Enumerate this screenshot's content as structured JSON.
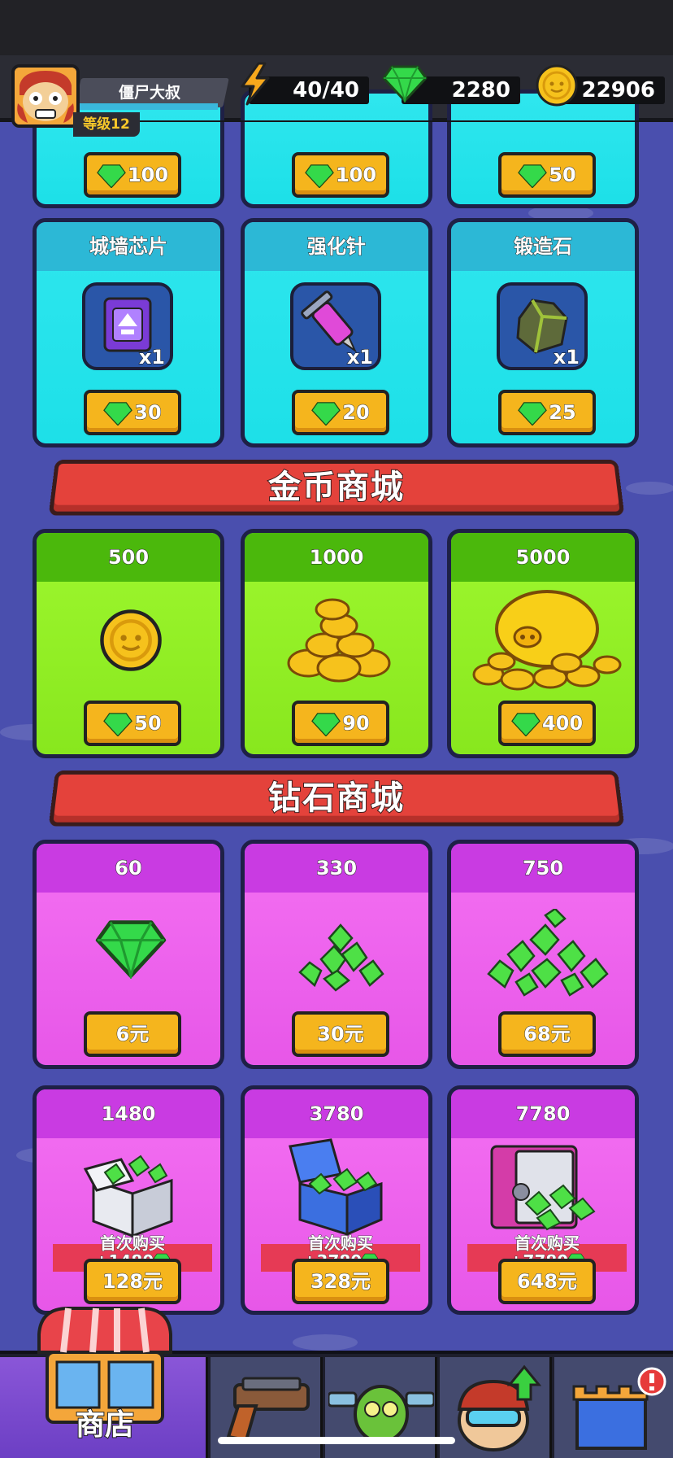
{
  "player": {
    "name": "僵尸大叔",
    "level": "等级12"
  },
  "resources": {
    "energy": "40/40",
    "gems": "2280",
    "coins": "22906"
  },
  "top_row": {
    "prices": [
      "100",
      "100",
      "50"
    ]
  },
  "item_row": [
    {
      "title": "城墙芯片",
      "qty": "x1",
      "price": "30",
      "icon": "wall-chip-icon"
    },
    {
      "title": "强化针",
      "qty": "x1",
      "price": "20",
      "icon": "syringe-icon"
    },
    {
      "title": "锻造石",
      "qty": "x1",
      "price": "25",
      "icon": "forge-stone-icon"
    }
  ],
  "gold_shop": {
    "title": "金币商城",
    "items": [
      {
        "amount": "500",
        "price": "50",
        "icon": "coin-icon"
      },
      {
        "amount": "1000",
        "price": "90",
        "icon": "coin-pile-icon"
      },
      {
        "amount": "5000",
        "price": "400",
        "icon": "gold-piggy-icon"
      }
    ]
  },
  "gem_shop": {
    "title": "钻石商城",
    "items": [
      {
        "amount": "60",
        "price": "6元",
        "icon": "gem-icon"
      },
      {
        "amount": "330",
        "price": "30元",
        "icon": "gem-pile-icon"
      },
      {
        "amount": "750",
        "price": "68元",
        "icon": "gem-big-pile-icon"
      },
      {
        "amount": "1480",
        "price": "128元",
        "first_buy": "首次购买",
        "bonus": "+1480",
        "icon": "gem-box-icon"
      },
      {
        "amount": "3780",
        "price": "328元",
        "first_buy": "首次购买",
        "bonus": "+3780",
        "icon": "gem-chest-icon"
      },
      {
        "amount": "7780",
        "price": "648元",
        "first_buy": "首次购买",
        "bonus": "+7780",
        "icon": "gem-safe-icon"
      }
    ]
  },
  "nav": {
    "shop_label": "商店",
    "tabs": [
      "shop-tab",
      "weapon-tab",
      "hero-tab",
      "upgrade-tab",
      "castle-tab"
    ]
  },
  "colors": {
    "cyan_card": "#1de0e8",
    "green_card": "#88e71e",
    "pink_card": "#e757e8",
    "gold_button": "#f5b51d",
    "red_banner": "#e4423b"
  }
}
